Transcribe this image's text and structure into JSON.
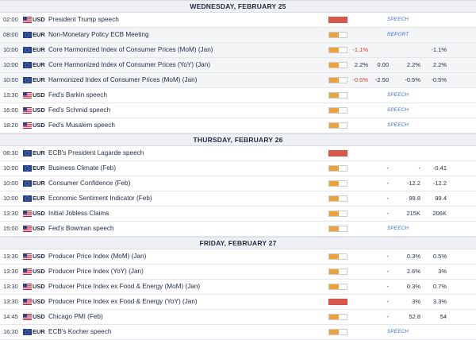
{
  "colors": {
    "high": "#d9584a",
    "medium": "#f0a23a",
    "negative": "#d23b2e",
    "badge": "#3b6fd6"
  },
  "sections": [
    {
      "title": "WEDNESDAY, FEBRUARY 25",
      "rows": [
        {
          "time": "02:00",
          "flag": "us-flag-icon",
          "currency": "USD",
          "event": "President Trump speech",
          "impact": "high",
          "impact_level": 1.0,
          "badge": "SPEECH",
          "actual": "",
          "deviation": "",
          "consensus": "",
          "previous": "",
          "shaded": false
        },
        {
          "time": "08:00",
          "flag": "eu-flag-icon",
          "currency": "EUR",
          "event": "Non-Monetary Policy ECB Meeting",
          "impact": "medium",
          "impact_level": 0.55,
          "badge": "REPORT",
          "actual": "",
          "deviation": "",
          "consensus": "",
          "previous": "",
          "shaded": true
        },
        {
          "time": "10:00",
          "flag": "eu-flag-icon",
          "currency": "EUR",
          "event": "Core Harmonized Index of Consumer Prices (MoM) (Jan)",
          "impact": "medium",
          "impact_level": 0.55,
          "badge": "",
          "actual": "-1.1%",
          "deviation": "",
          "consensus": "",
          "previous": "-1.1%",
          "shaded": true
        },
        {
          "time": "10:00",
          "flag": "eu-flag-icon",
          "currency": "EUR",
          "event": "Core Harmonized Index of Consumer Prices (YoY) (Jan)",
          "impact": "medium",
          "impact_level": 0.55,
          "badge": "",
          "actual": "2.2%",
          "deviation": "0.00",
          "consensus": "2.2%",
          "previous": "2.2%",
          "shaded": true
        },
        {
          "time": "10:00",
          "flag": "eu-flag-icon",
          "currency": "EUR",
          "event": "Harmonized Index of Consumer Prices (MoM) (Jan)",
          "impact": "medium",
          "impact_level": 0.55,
          "badge": "",
          "actual": "-0.6%",
          "deviation": "-2.50",
          "consensus": "-0.5%",
          "previous": "-0.5%",
          "shaded": true
        },
        {
          "time": "13:30",
          "flag": "us-flag-icon",
          "currency": "USD",
          "event": "Fed's Barkin speech",
          "impact": "medium",
          "impact_level": 0.55,
          "badge": "SPEECH",
          "actual": "",
          "deviation": "",
          "consensus": "",
          "previous": "",
          "shaded": false
        },
        {
          "time": "16:00",
          "flag": "us-flag-icon",
          "currency": "USD",
          "event": "Fed's Schmid speech",
          "impact": "medium",
          "impact_level": 0.55,
          "badge": "SPEECH",
          "actual": "",
          "deviation": "",
          "consensus": "",
          "previous": "",
          "shaded": false
        },
        {
          "time": "18:20",
          "flag": "us-flag-icon",
          "currency": "USD",
          "event": "Fed's Musalem speech",
          "impact": "medium",
          "impact_level": 0.55,
          "badge": "SPEECH",
          "actual": "",
          "deviation": "",
          "consensus": "",
          "previous": "",
          "shaded": false
        }
      ]
    },
    {
      "title": "THURSDAY, FEBRUARY 26",
      "rows": [
        {
          "time": "08:30",
          "flag": "eu-flag-icon",
          "currency": "EUR",
          "event": "ECB's President Lagarde speech",
          "impact": "high",
          "impact_level": 1.0,
          "badge": "",
          "actual": "",
          "deviation": "",
          "consensus": "",
          "previous": "",
          "shaded": false
        },
        {
          "time": "10:00",
          "flag": "eu-flag-icon",
          "currency": "EUR",
          "event": "Business Climate (Feb)",
          "impact": "medium",
          "impact_level": 0.55,
          "badge": "",
          "actual": "",
          "deviation": "-",
          "consensus": "-",
          "previous": "-0.41",
          "shaded": false
        },
        {
          "time": "10:00",
          "flag": "eu-flag-icon",
          "currency": "EUR",
          "event": "Consumer Confidence (Feb)",
          "impact": "medium",
          "impact_level": 0.55,
          "badge": "",
          "actual": "",
          "deviation": "-",
          "consensus": "-12.2",
          "previous": "-12.2",
          "shaded": false
        },
        {
          "time": "10:00",
          "flag": "eu-flag-icon",
          "currency": "EUR",
          "event": "Economic Sentiment Indicator (Feb)",
          "impact": "medium",
          "impact_level": 0.55,
          "badge": "",
          "actual": "",
          "deviation": "-",
          "consensus": "99.8",
          "previous": "99.4",
          "shaded": false
        },
        {
          "time": "13:30",
          "flag": "us-flag-icon",
          "currency": "USD",
          "event": "Initial Jobless Claims",
          "impact": "medium",
          "impact_level": 0.55,
          "badge": "",
          "actual": "",
          "deviation": "-",
          "consensus": "215K",
          "previous": "206K",
          "shaded": false
        },
        {
          "time": "15:00",
          "flag": "us-flag-icon",
          "currency": "USD",
          "event": "Fed's Bowman speech",
          "impact": "medium",
          "impact_level": 0.55,
          "badge": "SPEECH",
          "actual": "",
          "deviation": "",
          "consensus": "",
          "previous": "",
          "shaded": false
        }
      ]
    },
    {
      "title": "FRIDAY, FEBRUARY 27",
      "rows": [
        {
          "time": "13:30",
          "flag": "us-flag-icon",
          "currency": "USD",
          "event": "Producer Price Index (MoM) (Jan)",
          "impact": "medium",
          "impact_level": 0.55,
          "badge": "",
          "actual": "",
          "deviation": "-",
          "consensus": "0.3%",
          "previous": "0.5%",
          "shaded": false
        },
        {
          "time": "13:30",
          "flag": "us-flag-icon",
          "currency": "USD",
          "event": "Producer Price Index (YoY) (Jan)",
          "impact": "medium",
          "impact_level": 0.55,
          "badge": "",
          "actual": "",
          "deviation": "-",
          "consensus": "2.6%",
          "previous": "3%",
          "shaded": false
        },
        {
          "time": "13:30",
          "flag": "us-flag-icon",
          "currency": "USD",
          "event": "Producer Price Index ex Food & Energy (MoM) (Jan)",
          "impact": "medium",
          "impact_level": 0.55,
          "badge": "",
          "actual": "",
          "deviation": "-",
          "consensus": "0.3%",
          "previous": "0.7%",
          "shaded": false
        },
        {
          "time": "13:30",
          "flag": "us-flag-icon",
          "currency": "USD",
          "event": "Producer Price Index ex Food & Energy (YoY) (Jan)",
          "impact": "high",
          "impact_level": 1.0,
          "badge": "",
          "actual": "",
          "deviation": "-",
          "consensus": "3%",
          "previous": "3.3%",
          "shaded": false
        },
        {
          "time": "14:45",
          "flag": "us-flag-icon",
          "currency": "USD",
          "event": "Chicago PMI (Feb)",
          "impact": "medium",
          "impact_level": 0.55,
          "badge": "",
          "actual": "",
          "deviation": "-",
          "consensus": "52.8",
          "previous": "54",
          "shaded": false
        },
        {
          "time": "16:30",
          "flag": "eu-flag-icon",
          "currency": "EUR",
          "event": "ECB's Kocher speech",
          "impact": "medium",
          "impact_level": 0.55,
          "badge": "SPEECH",
          "actual": "",
          "deviation": "",
          "consensus": "",
          "previous": "",
          "shaded": false
        }
      ]
    }
  ]
}
